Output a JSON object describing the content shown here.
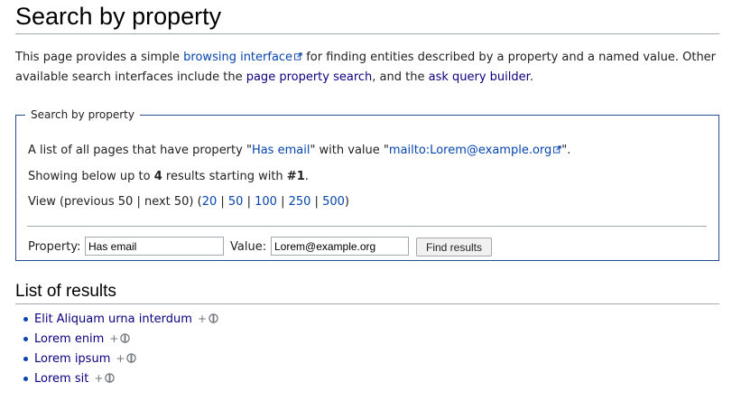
{
  "page": {
    "title": "Search by property",
    "intro": {
      "t1": "This page provides a simple ",
      "link1": "browsing interface",
      "t2": " for finding entities described by a property and a named value. Other available search interfaces include the ",
      "link2": "page property search",
      "t3": ", and the ",
      "link3": "ask query builder",
      "t4": "."
    }
  },
  "search_box": {
    "legend": "Search by property",
    "description": {
      "prefix": "A list of all pages that have property \"",
      "property_link": "Has email",
      "middle": "\" with value \"",
      "value_link": "mailto:Lorem@example.org",
      "suffix": "\"."
    },
    "showing": {
      "prefix": "Showing below up to ",
      "count": "4",
      "middle": " results starting with ",
      "start": "#1",
      "suffix": "."
    },
    "view": {
      "prefix": "View (previous 50 | next 50) (",
      "limits": [
        "20",
        "50",
        "100",
        "250",
        "500"
      ],
      "sep": " | ",
      "suffix": ")"
    },
    "form": {
      "property_label": "Property:",
      "property_value": "Has email",
      "value_label": "Value:",
      "value_value": "Lorem@example.org",
      "submit_label": "Find results"
    }
  },
  "results": {
    "heading": "List of results",
    "browse_symbol": "+",
    "items": [
      {
        "label": "Elit Aliquam urna interdum"
      },
      {
        "label": "Lorem enim"
      },
      {
        "label": "Lorem ipsum"
      },
      {
        "label": "Lorem sit"
      }
    ]
  },
  "colors": {
    "link": "#0645ad",
    "visited_link": "#0b0080",
    "fieldset_border": "#2a4b8d",
    "rule": "#a2a9b1"
  },
  "icons": {
    "external_link": "external-link-icon",
    "browse_info": "info-icon"
  }
}
